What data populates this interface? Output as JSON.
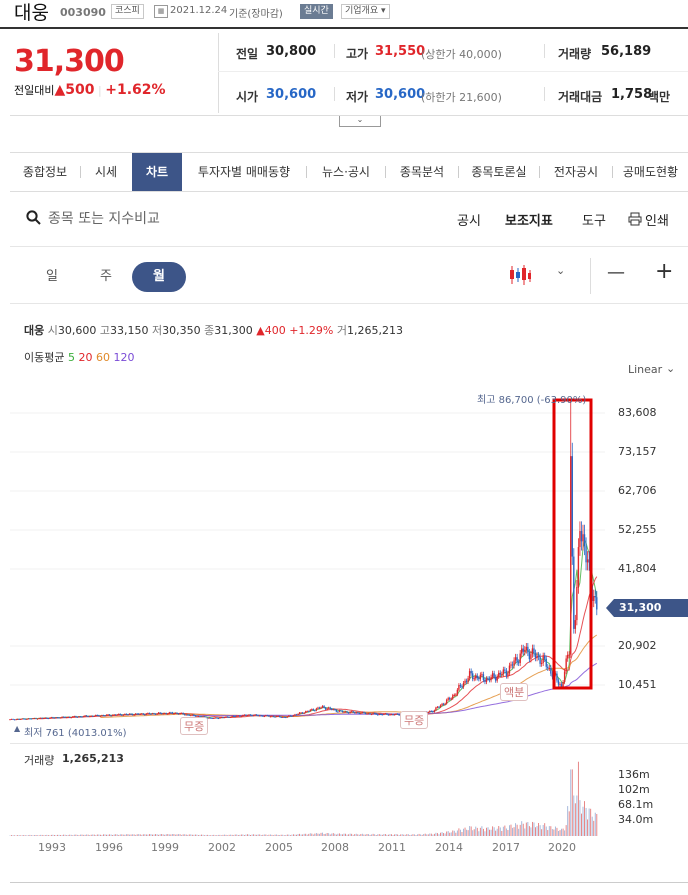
{
  "header": {
    "stock_name": "대웅",
    "stock_code": "003090",
    "market": "코스피",
    "date": "2021.12.24",
    "basis": "기준(장마감)",
    "realtime": "실시간",
    "company_info": "기업개요 ▾"
  },
  "quote": {
    "price": "31,300",
    "change_label": "전일대비",
    "change_arrow": "▲",
    "change": "500",
    "change_pct": "+1.62%",
    "prev_close_label": "전일",
    "prev_close": "30,800",
    "high_label": "고가",
    "high": "31,550",
    "upper_limit": "(상한가 40,000)",
    "volume_label": "거래량",
    "volume": "56,189",
    "open_label": "시가",
    "open": "30,600",
    "low_label": "저가",
    "low": "30,600",
    "lower_limit": "(하한가 21,600)",
    "amount_label": "거래대금",
    "amount": "1,758",
    "amount_unit": "백만"
  },
  "tabs": [
    "종합정보",
    "시세",
    "차트",
    "투자자별 매매동향",
    "뉴스·공시",
    "종목분석",
    "종목토론실",
    "전자공시",
    "공매도현황"
  ],
  "toolbar": {
    "search_placeholder": "종목 또는 지수비교",
    "notice": "공시",
    "indicator": "보조지표",
    "tools": "도구",
    "print": "인쇄"
  },
  "periods": [
    "일",
    "주",
    "월"
  ],
  "zoom": {
    "minus": "—",
    "plus": "+"
  },
  "legend": {
    "name": "대웅",
    "o_label": "시",
    "o": "30,600",
    "h_label": "고",
    "h": "33,150",
    "l_label": "저",
    "l": "30,350",
    "c_label": "종",
    "c": "31,300",
    "chg": "▲400 +1.29%",
    "v_label": "거",
    "v": "1,265,213"
  },
  "ma": {
    "label": "이동평균",
    "periods": [
      "5",
      "20",
      "60",
      "120"
    ],
    "colors": [
      "#3cae3c",
      "#e0262b",
      "#e08a2b",
      "#7a4bd6"
    ]
  },
  "scale": "Linear",
  "annotations": {
    "max": "최고 86,700 (-63.90%)",
    "min": "최저 761 (4013.01%)",
    "events": [
      "무증",
      "무증",
      "액분"
    ],
    "current": "31,300"
  },
  "volume_label": "거래량",
  "volume_value": "1,265,213",
  "chart_data": {
    "type": "candlestick",
    "scale": "linear",
    "y_ticks": [
      "83,608",
      "73,157",
      "62,706",
      "52,255",
      "41,804",
      "20,902",
      "10,451"
    ],
    "x_ticks": [
      "1993",
      "1996",
      "1999",
      "2002",
      "2005",
      "2008",
      "2011",
      "2014",
      "2017",
      "2020"
    ],
    "volume_ticks": [
      "136m",
      "102m",
      "68.1m",
      "34.0m"
    ],
    "series": [
      {
        "name": "close",
        "x": [
          1990,
          1993,
          1996,
          1999,
          2001,
          2003,
          2005,
          2007,
          2008,
          2010,
          2012,
          2013,
          2014,
          2015,
          2016,
          2017,
          2018,
          2019,
          2020,
          2020.5,
          2020.8,
          2021,
          2021.5,
          2021.9
        ],
        "values": [
          1200,
          1800,
          2500,
          2900,
          1500,
          2400,
          1800,
          4500,
          3300,
          2600,
          2400,
          3500,
          7000,
          13000,
          12000,
          14000,
          20000,
          17000,
          10000,
          22000,
          30000,
          55000,
          40000,
          31300
        ]
      }
    ]
  }
}
